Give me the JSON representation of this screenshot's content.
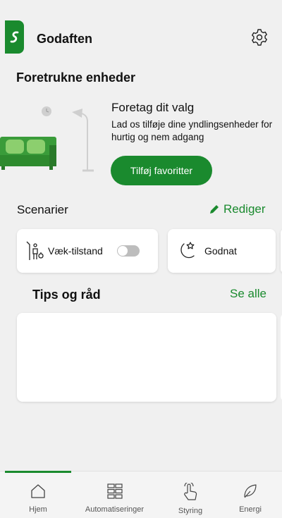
{
  "header": {
    "title": "Godaften",
    "brand_icon": "brand-logo-icon",
    "settings_icon": "gear-icon"
  },
  "favorites": {
    "section_title": "Foretrukne enheder",
    "heading": "Foretag dit valg",
    "description": "Lad os tilføje dine yndlingsenheder for hurtig og nem adgang",
    "button_label": "Tilføj favoritter"
  },
  "scenarios": {
    "section_title": "Scenarier",
    "edit_label": "Rediger",
    "edit_icon": "pencil-icon",
    "items": [
      {
        "label": "Væk-tilstand",
        "icon": "away-person-icon",
        "has_toggle": true,
        "toggle_on": false
      },
      {
        "label": "Godnat",
        "icon": "moon-star-icon",
        "has_toggle": false
      }
    ]
  },
  "tips": {
    "section_title": "Tips og råd",
    "see_all_label": "Se alle"
  },
  "bottom_nav": {
    "active_index": 0,
    "items": [
      {
        "label": "Hjem",
        "icon": "home-icon"
      },
      {
        "label": "Automatiseringer",
        "icon": "grid-icon"
      },
      {
        "label": "Styring",
        "icon": "hand-tap-icon"
      },
      {
        "label": "Energi",
        "icon": "leaf-icon"
      }
    ]
  },
  "colors": {
    "accent": "#1a8a2e",
    "background": "#f0f0f0",
    "card": "#ffffff",
    "sofa": "#3a9c3a"
  }
}
